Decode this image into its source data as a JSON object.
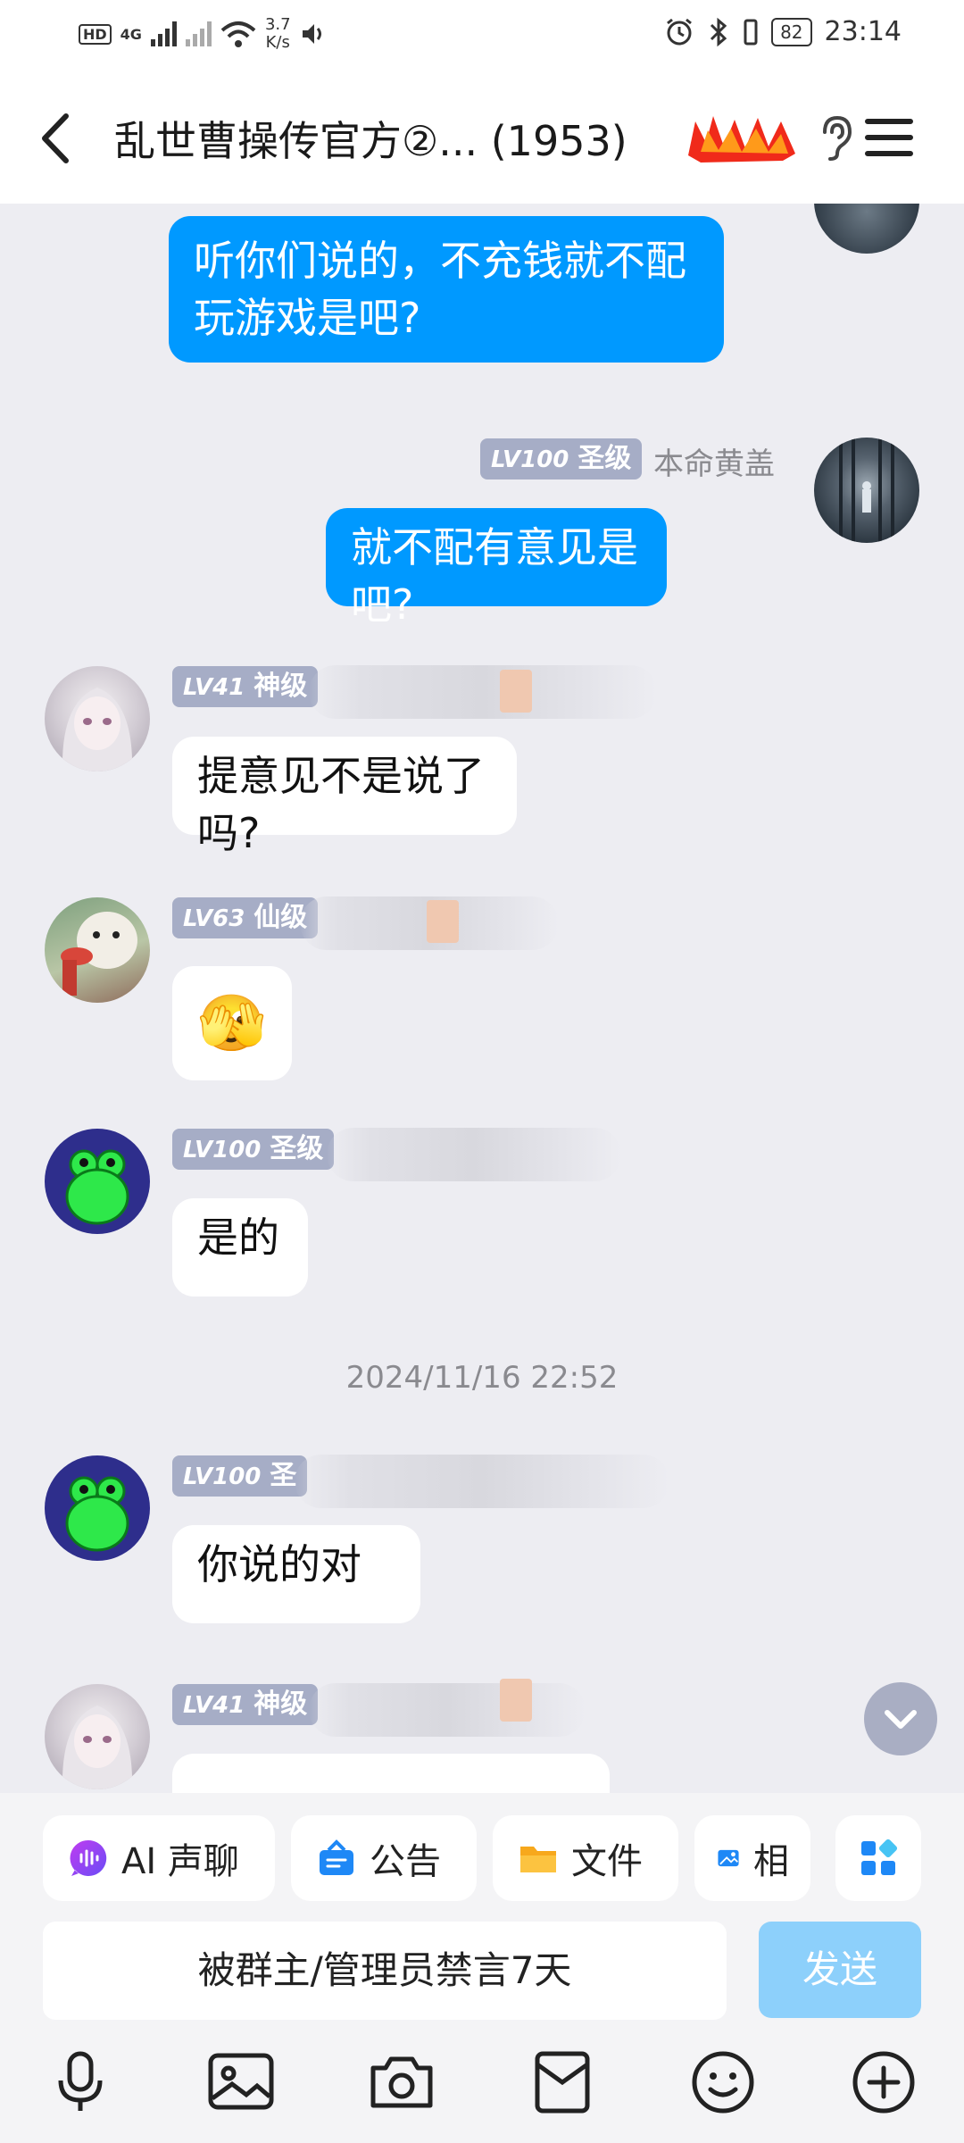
{
  "status_bar": {
    "hd": "HD",
    "net": "4G",
    "speed": "3.7",
    "speed_unit": "K/s",
    "battery": "82",
    "time": "23:14"
  },
  "header": {
    "title": "乱世曹操传官方②... (1953)"
  },
  "messages": [
    {
      "side": "out",
      "text": "听你们说的，不充钱就不配玩游戏是吧?"
    },
    {
      "side": "out",
      "level": "LV100",
      "rank": "圣级",
      "sender": "本命黄盖",
      "text": "就不配有意见是吧?"
    },
    {
      "side": "in",
      "level": "LV41",
      "rank": "神级",
      "text": "提意见不是说了吗?"
    },
    {
      "side": "in",
      "level": "LV63",
      "rank": "仙级",
      "emoji": "🫣"
    },
    {
      "side": "in",
      "level": "LV100",
      "rank": "圣级",
      "text": "是的"
    },
    {
      "side": "in",
      "level": "LV100",
      "rank": "圣",
      "text": "你说的对"
    },
    {
      "side": "in",
      "level": "LV41",
      "rank": "神级"
    }
  ],
  "timestamp": "2024/11/16 22:52",
  "quick_actions": [
    {
      "label": "AI 声聊",
      "icon": "ai-voice-chat-icon"
    },
    {
      "label": "公告",
      "icon": "announcement-icon"
    },
    {
      "label": "文件",
      "icon": "folder-icon"
    },
    {
      "label": "相",
      "icon": "album-icon"
    }
  ],
  "input": {
    "placeholder": "被群主/管理员禁言7天",
    "send_label": "发送"
  },
  "bottom_icons": [
    "microphone-icon",
    "image-icon",
    "camera-icon",
    "red-packet-icon",
    "emoji-icon",
    "plus-icon"
  ],
  "colors": {
    "accent": "#0099ff",
    "send_disabled": "#8dd0fb",
    "level_tag": "#a6adc6",
    "background": "#ededf2"
  }
}
